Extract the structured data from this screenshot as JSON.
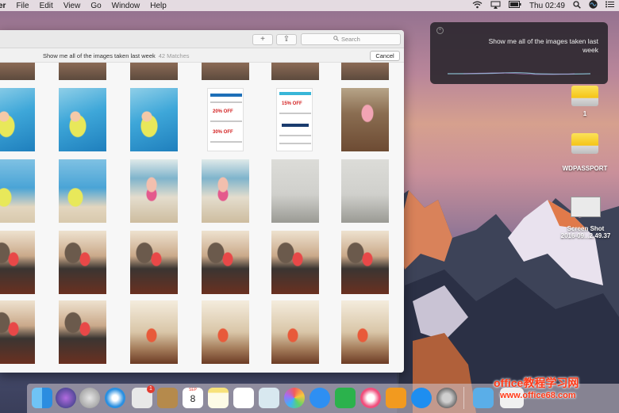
{
  "menubar": {
    "app": "er",
    "items": [
      "File",
      "Edit",
      "View",
      "Go",
      "Window",
      "Help"
    ],
    "clock": "Thu 02:49"
  },
  "siri": {
    "query": "Show me all of the images taken last week"
  },
  "photos_window": {
    "add_label": "+",
    "share_label": "⇪",
    "search_placeholder": "Search",
    "query": "Show me all of the images taken last week",
    "matches": "42 Matches",
    "cancel_label": "Cancel"
  },
  "ads": {
    "ad1_off1": "20% OFF",
    "ad1_off2": "30% OFF",
    "ad2_off": "15% OFF"
  },
  "desktop": {
    "drive1_label": "1",
    "drive2_label": "WDPASSPORT",
    "screenshot_label1": "Screen Shot",
    "screenshot_label2": "2016-09...2.49.37"
  },
  "dock": {
    "calendar_day": "8",
    "calendar_month": "SEP",
    "mail_badge": "1"
  },
  "watermark": {
    "line1": "office教程学习网",
    "line2": "www.office68.com"
  },
  "colors": {
    "menubar": "#ebe4e8",
    "siri_panel": "#2e2830",
    "window": "#f7f7f7",
    "drive": "#f5c416"
  },
  "icons": [
    "apple-menu",
    "wifi-icon",
    "airplay-icon",
    "battery-icon",
    "spotlight-icon",
    "siri-icon",
    "notification-center-icon"
  ]
}
